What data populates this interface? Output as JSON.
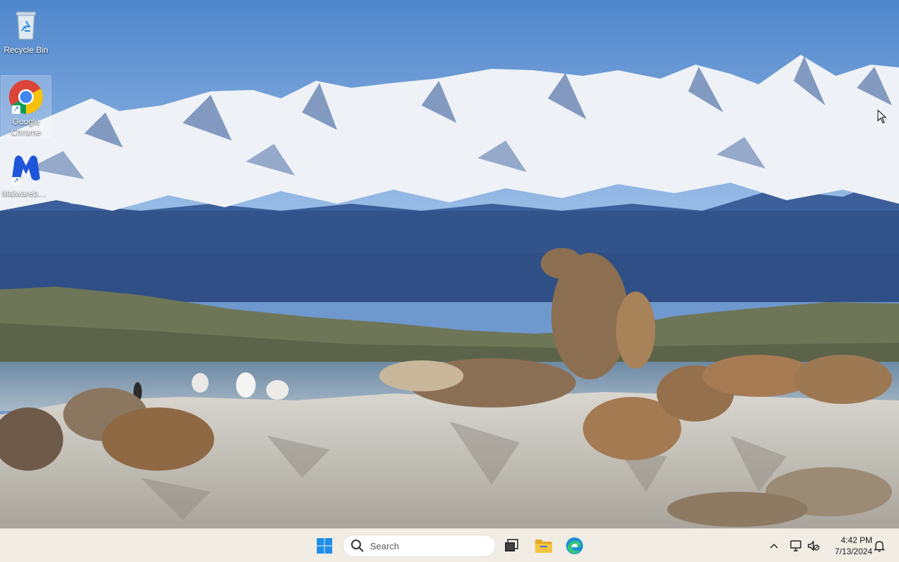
{
  "desktop": {
    "icons": [
      {
        "label": "Recycle Bin",
        "icon": "recycle-bin-icon"
      },
      {
        "label": "Google Chrome",
        "icon": "chrome-icon"
      },
      {
        "label": "Malwarebytes",
        "icon": "malwarebytes-icon"
      }
    ]
  },
  "taskbar": {
    "search": {
      "placeholder": "Search"
    },
    "apps": [
      {
        "name": "Start",
        "icon": "windows-start-icon"
      },
      {
        "name": "Task View",
        "icon": "task-view-icon"
      },
      {
        "name": "File Explorer",
        "icon": "folder-icon"
      },
      {
        "name": "Microsoft Edge",
        "icon": "edge-icon"
      }
    ],
    "tray": {
      "time": "4:42 PM",
      "date": "7/13/2024"
    }
  },
  "colors": {
    "taskbar_bg": "#f1ece4",
    "start_blue": "#1f8ee8",
    "folder_yellow": "#f5c342"
  }
}
